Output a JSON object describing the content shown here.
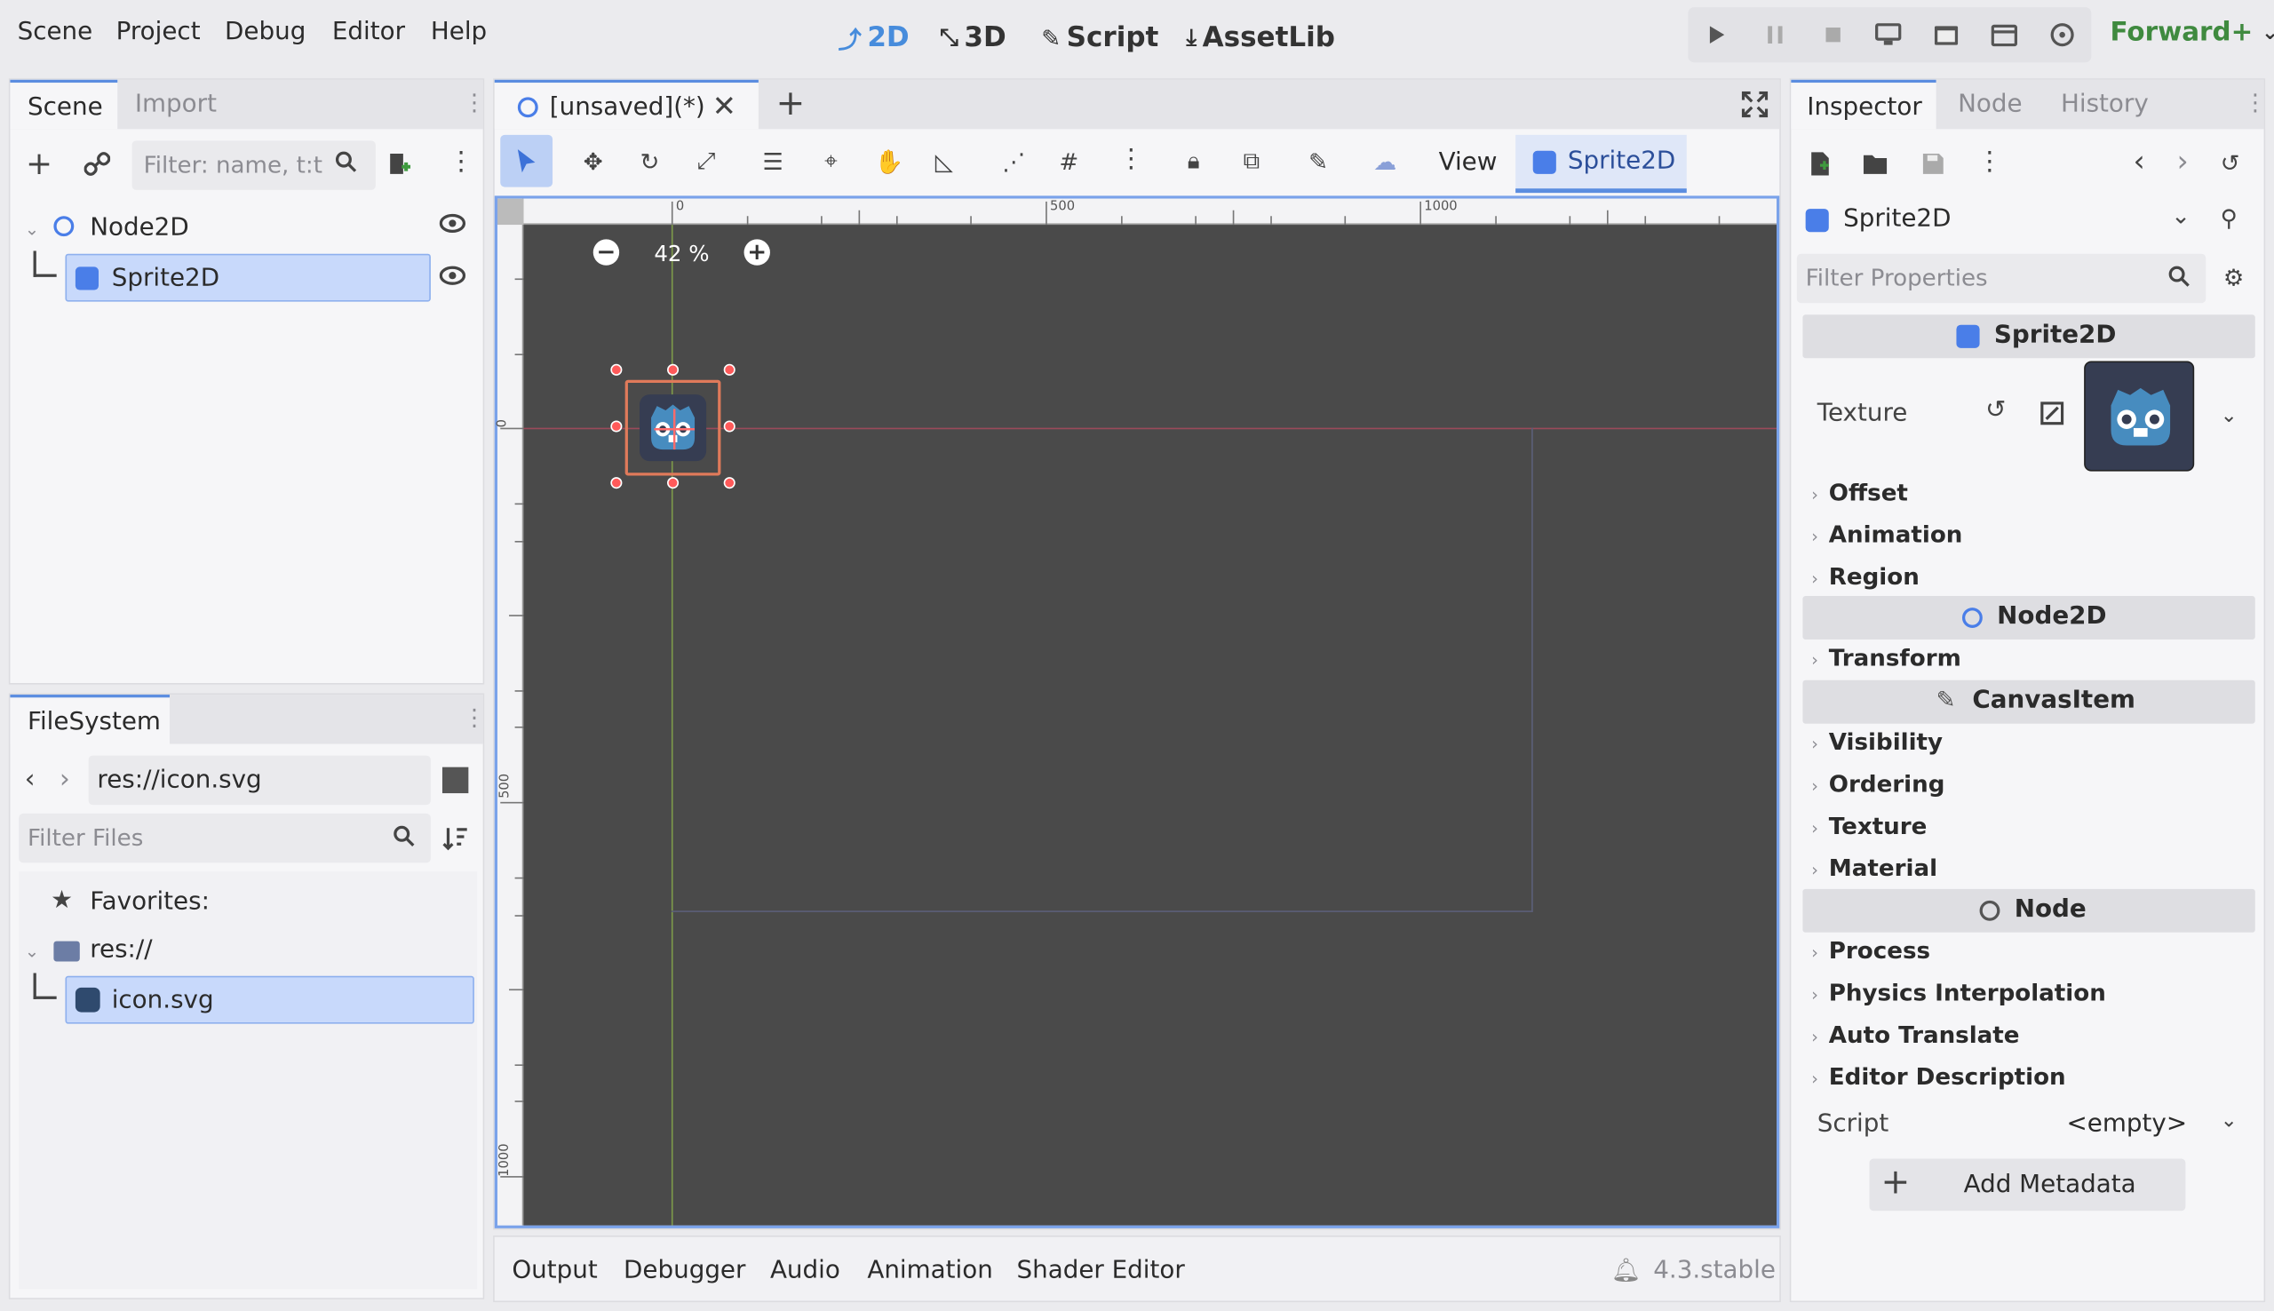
{
  "menu": [
    "Scene",
    "Project",
    "Debug",
    "Editor",
    "Help"
  ],
  "workspaces": [
    {
      "label": "2D",
      "icon": "2d-icon",
      "active": true
    },
    {
      "label": "3D",
      "icon": "3d-icon"
    },
    {
      "label": "Script",
      "icon": "script-icon"
    },
    {
      "label": "AssetLib",
      "icon": "assetlib-icon"
    }
  ],
  "renderer": "Forward+",
  "scene_dock": {
    "tabs": [
      "Scene",
      "Import"
    ],
    "filter_placeholder": "Filter: name, t:t",
    "tree": [
      {
        "label": "Node2D",
        "icon": "node2d-icon"
      },
      {
        "label": "Sprite2D",
        "icon": "sprite2d-icon",
        "selected": true
      }
    ]
  },
  "filesystem": {
    "tab": "FileSystem",
    "path": "res://icon.svg",
    "filter_placeholder": "Filter Files",
    "favorites": "Favorites:",
    "root": "res://",
    "file": "icon.svg"
  },
  "editor": {
    "tab": "[unsaved](*)",
    "view_label": "View",
    "sprite_label": "Sprite2D",
    "zoom": "42 %",
    "ruler_h": [
      "0",
      "500",
      "1000"
    ],
    "ruler_v": [
      "0",
      "500",
      "1000"
    ]
  },
  "bottom_panel": {
    "tabs": [
      "Output",
      "Debugger",
      "Audio",
      "Animation",
      "Shader Editor"
    ],
    "version": "4.3.stable"
  },
  "inspector": {
    "tabs": [
      "Inspector",
      "Node",
      "History"
    ],
    "object": "Sprite2D",
    "filter_placeholder": "Filter Properties",
    "section_sprite": "Sprite2D",
    "texture_label": "Texture",
    "sprite_groups": [
      "Offset",
      "Animation",
      "Region"
    ],
    "section_node2d": "Node2D",
    "node2d_groups": [
      "Transform"
    ],
    "section_canvas": "CanvasItem",
    "canvas_groups": [
      "Visibility",
      "Ordering",
      "Texture",
      "Material"
    ],
    "section_node": "Node",
    "node_groups": [
      "Process",
      "Physics Interpolation",
      "Auto Translate",
      "Editor Description"
    ],
    "script_label": "Script",
    "script_value": "<empty>",
    "add_metadata": "Add Metadata"
  },
  "colors": {
    "accent": "#5b8de0",
    "viewport": "#4a4a4a",
    "selection": "#c8d9fb",
    "godot_blue": "#478cbf"
  }
}
